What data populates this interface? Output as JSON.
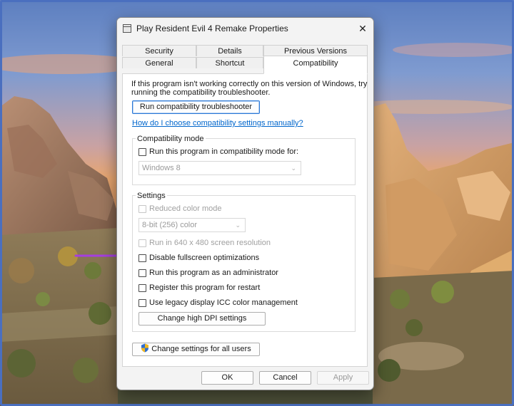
{
  "window": {
    "title": "Play Resident Evil 4 Remake Properties",
    "close_glyph": "✕"
  },
  "tabs": {
    "row1": [
      "Security",
      "Details",
      "Previous Versions"
    ],
    "row2": [
      "General",
      "Shortcut",
      "Compatibility"
    ],
    "active": "Compatibility"
  },
  "intro": {
    "line1": "If this program isn't working correctly on this version of Windows, try",
    "line2": "running the compatibility troubleshooter."
  },
  "troubleshooter_button": "Run compatibility troubleshooter",
  "help_link": "How do I choose compatibility settings manually?",
  "compat_mode": {
    "legend": "Compatibility mode",
    "checkbox": "Run this program in compatibility mode for:",
    "select_value": "Windows 8"
  },
  "settings": {
    "legend": "Settings",
    "reduced_color": "Reduced color mode",
    "color_select_value": "8-bit (256) color",
    "run_640": "Run in 640 x 480 screen resolution",
    "disable_fullscreen": "Disable fullscreen optimizations",
    "run_admin": "Run this program as an administrator",
    "register_restart": "Register this program for restart",
    "legacy_icc": "Use legacy display ICC color management",
    "high_dpi_button": "Change high DPI settings"
  },
  "all_users_button": "Change settings for all users",
  "footer": {
    "ok": "OK",
    "cancel": "Cancel",
    "apply": "Apply"
  },
  "annotation": {
    "arrow_color": "#a53ee0"
  },
  "icons": {
    "app": "app-window-icon",
    "close": "close-icon",
    "uac": "uac-shield-icon",
    "dropdown": "chevron-down-icon"
  }
}
